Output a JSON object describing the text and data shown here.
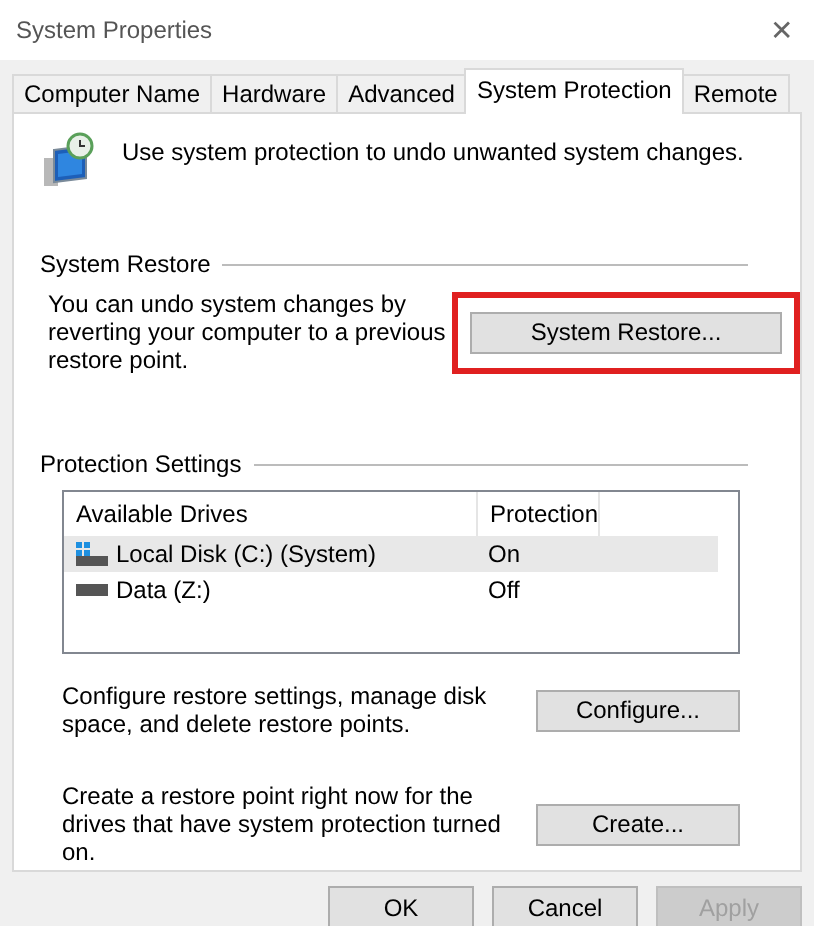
{
  "window": {
    "title": "System Properties",
    "close": "✕"
  },
  "tabs": [
    {
      "label": "Computer Name",
      "selected": false
    },
    {
      "label": "Hardware",
      "selected": false
    },
    {
      "label": "Advanced",
      "selected": false
    },
    {
      "label": "System Protection",
      "selected": true
    },
    {
      "label": "Remote",
      "selected": false
    }
  ],
  "intro": "Use system protection to undo unwanted system changes.",
  "system_restore": {
    "heading": "System Restore",
    "text": "You can undo system changes by reverting your computer to a previous restore point.",
    "button": {
      "label": "System Restore...",
      "highlighted": true
    }
  },
  "protection_settings": {
    "heading": "Protection Settings",
    "columns": [
      "Available Drives",
      "Protection"
    ],
    "rows": [
      {
        "kind": "system",
        "drive": "Local Disk (C:) (System)",
        "protection": "On",
        "selected": true
      },
      {
        "kind": "data",
        "drive": "Data (Z:)",
        "protection": "Off",
        "selected": false
      }
    ]
  },
  "actions": [
    {
      "text": "Configure restore settings, manage disk space, and delete restore points.",
      "button": "Configure..."
    },
    {
      "text": "Create a restore point right now for the drives that have system protection turned on.",
      "button": "Create..."
    }
  ],
  "buttons": [
    {
      "label": "OK",
      "disabled": false
    },
    {
      "label": "Cancel",
      "disabled": false
    },
    {
      "label": "Apply",
      "disabled": true
    }
  ]
}
